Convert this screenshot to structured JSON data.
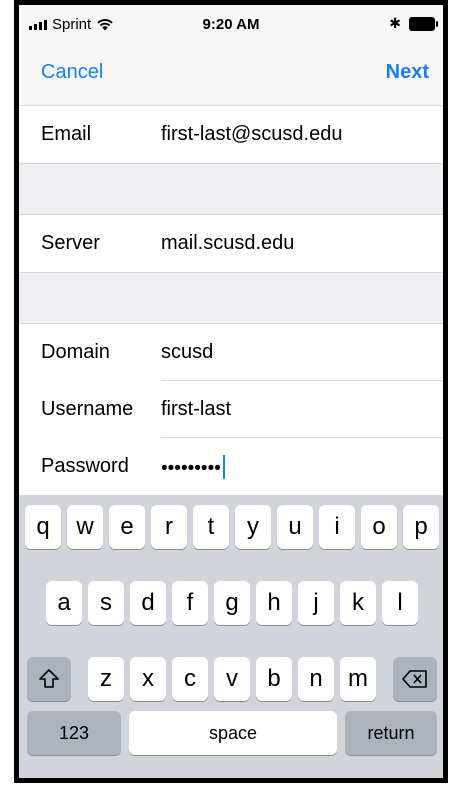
{
  "status_bar": {
    "carrier": "Sprint",
    "time": "9:20 AM",
    "icons": [
      "signal-bars-icon",
      "wifi-icon",
      "bluetooth-icon",
      "battery-icon"
    ]
  },
  "nav": {
    "cancel_label": "Cancel",
    "next_label": "Next",
    "accent_color": "#1a7cf6"
  },
  "fields": {
    "email": {
      "label": "Email",
      "value": "first-last@scusd.edu"
    },
    "server": {
      "label": "Server",
      "value": "mail.scusd.edu"
    },
    "domain": {
      "label": "Domain",
      "value": "scusd"
    },
    "username": {
      "label": "Username",
      "value": "first-last"
    },
    "password": {
      "label": "Password",
      "value": "•••••••••"
    }
  },
  "keyboard": {
    "row1": [
      "q",
      "w",
      "e",
      "r",
      "t",
      "y",
      "u",
      "i",
      "o",
      "p"
    ],
    "row2": [
      "a",
      "s",
      "d",
      "f",
      "g",
      "h",
      "j",
      "k",
      "l"
    ],
    "row3": [
      "z",
      "x",
      "c",
      "v",
      "b",
      "n",
      "m"
    ],
    "numbers_label": "123",
    "space_label": "space",
    "return_label": "return",
    "shift_icon": "shift-icon",
    "delete_icon": "backspace-icon"
  }
}
